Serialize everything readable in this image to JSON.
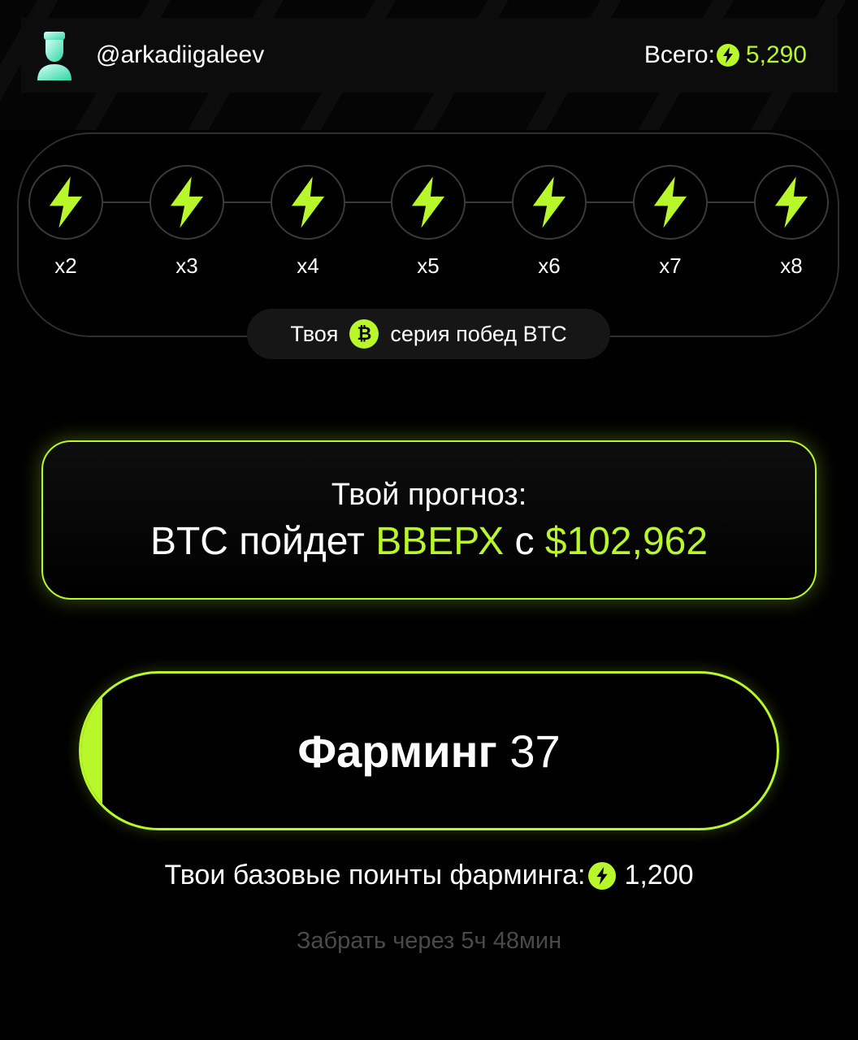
{
  "header": {
    "username": "@arkadiigaleev",
    "avatar_icon": "user-bust-icon",
    "total_label": "Всего:",
    "total_icon": "bolt-icon",
    "total_value": "5,290"
  },
  "streak": {
    "multipliers": [
      "x2",
      "x3",
      "x4",
      "x5",
      "x6",
      "x7",
      "x8"
    ],
    "node_icon": "bolt-icon",
    "label_before": "Твоя",
    "coin_icon": "bitcoin-icon",
    "label_after": "серия побед BTC"
  },
  "forecast": {
    "title": "Твой прогноз:",
    "line_prefix": "BTC пойдет",
    "direction": "ВВЕРХ",
    "connector": "с",
    "price": "$102,962"
  },
  "farming": {
    "label": "Фарминг",
    "count": "37",
    "progress_fraction": 0.03
  },
  "base_points": {
    "label": "Твои базовые поинты фарминга:",
    "icon": "bolt-icon",
    "value": "1,200"
  },
  "claim": {
    "text": "Забрать через 5ч 48мин"
  },
  "colors": {
    "accent": "#b8f72a",
    "background": "#000000"
  }
}
